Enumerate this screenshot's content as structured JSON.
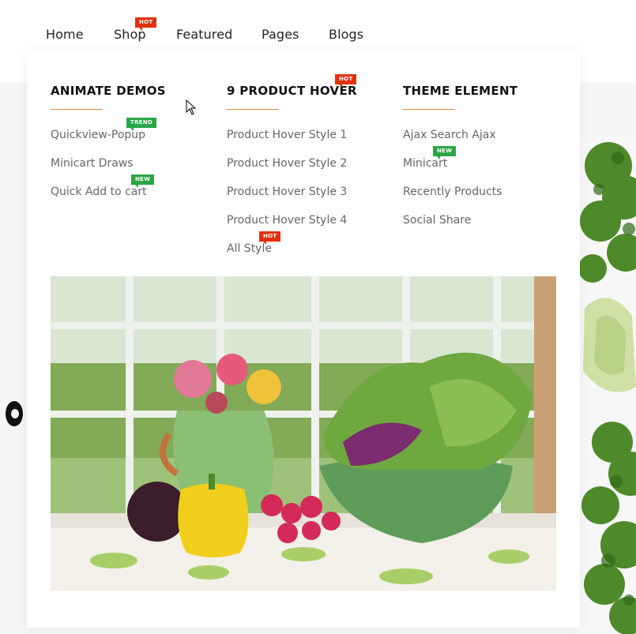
{
  "nav": {
    "items": [
      {
        "label": "Home"
      },
      {
        "label": "Shop",
        "badge": "HOT"
      },
      {
        "label": "Featured"
      },
      {
        "label": "Pages"
      },
      {
        "label": "Blogs"
      }
    ]
  },
  "mega_menu": {
    "columns": [
      {
        "title": "ANIMATE DEMOS",
        "links": [
          {
            "label": "Quickview-Popup",
            "badge": "TREND"
          },
          {
            "label": "Minicart Draws"
          },
          {
            "label": "Quick Add to cart",
            "badge": "NEW"
          }
        ]
      },
      {
        "title": "9 PRODUCT HOVER",
        "title_badge": "HOT",
        "links": [
          {
            "label": "Product Hover Style 1"
          },
          {
            "label": "Product Hover Style 2"
          },
          {
            "label": "Product Hover Style 3"
          },
          {
            "label": "Product Hover Style 4"
          },
          {
            "label": "All Style",
            "badge": "HOT"
          }
        ]
      },
      {
        "title": "THEME ELEMENT",
        "links": [
          {
            "label": "Ajax Search Ajax"
          },
          {
            "label": "Minicart",
            "badge": "NEW"
          },
          {
            "label": "Recently Products"
          },
          {
            "label": "Social Share"
          }
        ]
      }
    ]
  },
  "colors": {
    "hot_badge": "#e3300f",
    "new_badge": "#28a745",
    "title_underline": "#d98b3a"
  }
}
